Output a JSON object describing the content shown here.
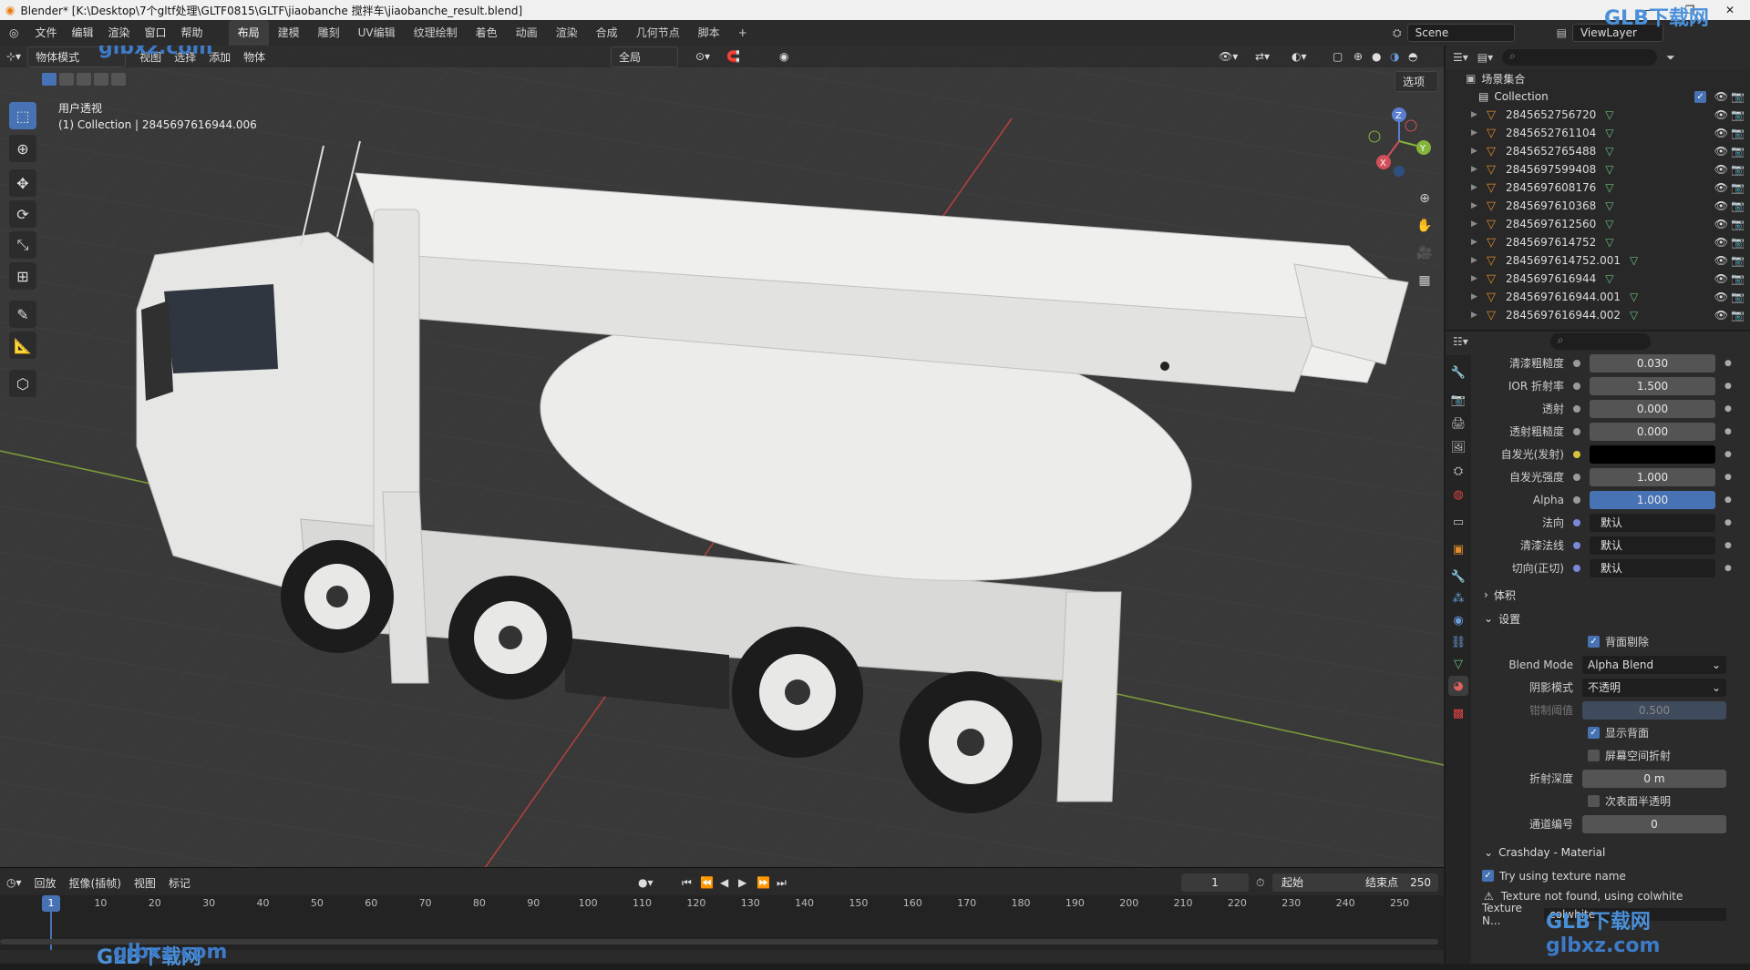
{
  "window": {
    "title": "Blender* [K:\\Desktop\\7个gltf处理\\GLTF0815\\GLTF\\jiaobanche 搅拌车\\jiaobanche_result.blend]"
  },
  "menu": [
    "文件",
    "编辑",
    "渲染",
    "窗口",
    "帮助"
  ],
  "workspaces": [
    "布局",
    "建模",
    "雕刻",
    "UV编辑",
    "纹理绘制",
    "着色",
    "动画",
    "渲染",
    "合成",
    "几何节点",
    "脚本"
  ],
  "workspace_add": "+",
  "scene": {
    "name": "Scene",
    "view_layer": "ViewLayer"
  },
  "viewport_header": {
    "mode": "物体模式",
    "menus": [
      "视图",
      "选择",
      "添加",
      "物体"
    ],
    "orientation": "全局",
    "options": "选项"
  },
  "viewport": {
    "view_name": "用户透视",
    "collection_info": "(1) Collection | 2845697616944.006",
    "gizmo": {
      "z": "Z",
      "y": "Y",
      "x": "X"
    }
  },
  "outliner": {
    "root": "场景集合",
    "collection": "Collection",
    "items": [
      "2845652756720",
      "2845652761104",
      "2845652765488",
      "2845697599408",
      "2845697608176",
      "2845697610368",
      "2845697612560",
      "2845697614752",
      "2845697614752.001",
      "2845697616944",
      "2845697616944.001",
      "2845697616944.002"
    ]
  },
  "properties": {
    "rows": [
      {
        "label": "清漆粗糙度",
        "value": "0.030",
        "style": "normal",
        "dot": "gray"
      },
      {
        "label": "IOR 折射率",
        "value": "1.500",
        "style": "normal",
        "dot": "gray"
      },
      {
        "label": "透射",
        "value": "0.000",
        "style": "normal",
        "dot": "gray"
      },
      {
        "label": "透射粗糙度",
        "value": "0.000",
        "style": "normal",
        "dot": "gray"
      },
      {
        "label": "自发光(发射)",
        "value": "",
        "style": "black",
        "dot": "yellow"
      },
      {
        "label": "自发光强度",
        "value": "1.000",
        "style": "normal",
        "dot": "gray"
      },
      {
        "label": "Alpha",
        "value": "1.000",
        "style": "blue",
        "dot": "gray"
      },
      {
        "label": "法向",
        "value": "默认",
        "style": "dark",
        "dot": "blue"
      },
      {
        "label": "清漆法线",
        "value": "默认",
        "style": "dark",
        "dot": "blue"
      },
      {
        "label": "切向(正切)",
        "value": "默认",
        "style": "dark",
        "dot": "blue"
      }
    ],
    "section_volume": "体积",
    "section_settings": "设置",
    "backface_culling": "背面剔除",
    "blend_mode_label": "Blend Mode",
    "blend_mode": "Alpha Blend",
    "shadow_mode_label": "阴影模式",
    "shadow_mode": "不透明",
    "clip_threshold_label": "钳制阈值",
    "clip_threshold": "0.500",
    "show_backface": "显示背面",
    "screen_refraction": "屏幕空间折射",
    "refraction_depth_label": "折射深度",
    "refraction_depth": "0 m",
    "subsurface_translucency": "次表面半透明",
    "pass_index_label": "通道编号",
    "pass_index": "0",
    "crashday_section": "Crashday - Material",
    "try_texture_name": "Try using texture name",
    "texture_warning": "Texture not found, using colwhite",
    "texture_label": "Texture N...",
    "texture_value": "colwhite"
  },
  "timeline": {
    "menus": [
      "回放",
      "抠像(插帧)",
      "视图",
      "标记"
    ],
    "current_frame": "1",
    "start_label": "起始",
    "start": "1",
    "end_label": "结束点",
    "end": "250",
    "ticks": [
      "1",
      "10",
      "20",
      "30",
      "40",
      "50",
      "60",
      "70",
      "80",
      "90",
      "100",
      "110",
      "120",
      "130",
      "140",
      "150",
      "160",
      "170",
      "180",
      "190",
      "200",
      "210",
      "220",
      "230",
      "240",
      "250"
    ]
  },
  "watermark": {
    "brand": "GLB下载网",
    "url": "glbxz.com"
  },
  "colors": {
    "accent": "#4772b3",
    "mesh": "#e08b2d",
    "truck": "#e6e6e4",
    "grid_x": "#b04040",
    "grid_y": "#7a9a3a"
  }
}
